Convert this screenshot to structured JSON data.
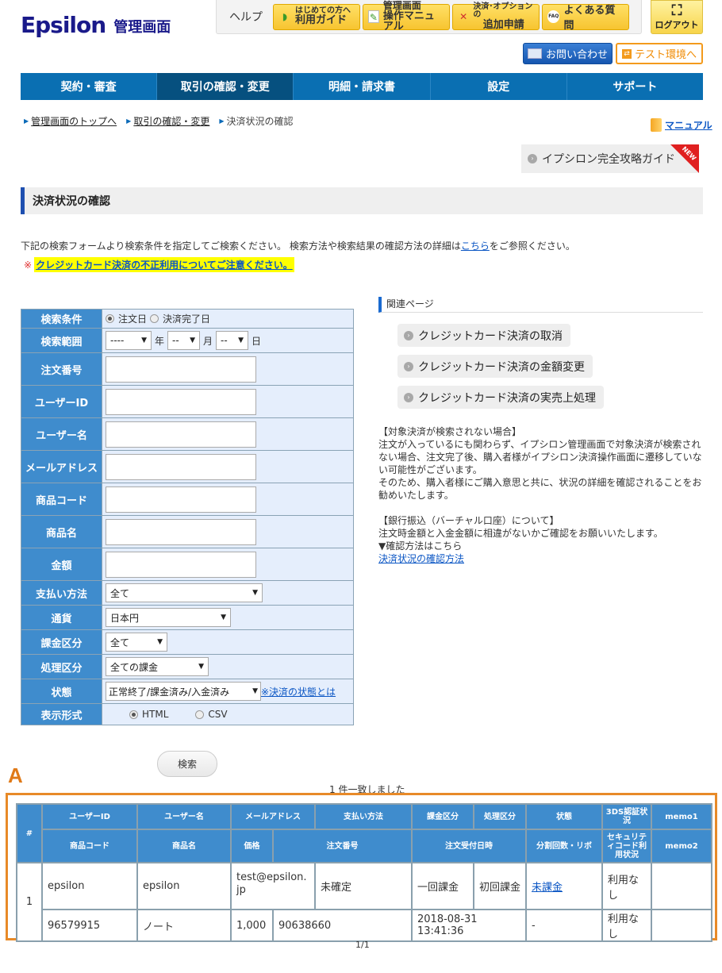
{
  "header": {
    "logo_main": "Epsilon",
    "logo_sub": "管理画面",
    "help_label": "ヘルプ",
    "help_buttons": [
      {
        "icon": "beginner-mark-icon",
        "small": "はじめての方へ",
        "large": "利用ガイド"
      },
      {
        "icon": "pencil-icon",
        "small": "管理画面",
        "large": "操作マニュアル"
      },
      {
        "icon": "tools-icon",
        "small": "決済･オプションの",
        "large": "追加申請"
      },
      {
        "icon": "faq-icon",
        "single": "よくある質問"
      }
    ],
    "logout_label": "ログアウト",
    "contact_label": "お問い合わせ",
    "test_env_label": "テスト環境へ"
  },
  "nav": {
    "items": [
      "契約・審査",
      "取引の確認・変更",
      "明細・請求書",
      "設定",
      "サポート"
    ],
    "active_index": 1
  },
  "breadcrumb": {
    "items": [
      "管理画面のトップへ",
      "取引の確認・変更"
    ],
    "current": "決済状況の確認"
  },
  "manual_link": "マニュアル",
  "guide_banner": {
    "label": "イプシロン完全攻略ガイド",
    "badge": "NEW"
  },
  "page_title": "決済状況の確認",
  "intro": {
    "before": "下記の検索フォームより検索条件を指定してご検索ください。 検索方法や検索結果の確認方法の詳細は",
    "link": "こちら",
    "after": "をご参照ください。"
  },
  "warning": {
    "mark": "※",
    "link": "クレジットカード決済の不正利用についてご注意ください。"
  },
  "search_form": {
    "condition": {
      "label": "検索条件",
      "options": [
        "注文日",
        "決済完了日"
      ],
      "selected": "注文日"
    },
    "range": {
      "label": "検索範囲",
      "year": "----",
      "year_unit": "年",
      "month": "--",
      "month_unit": "月",
      "day": "--",
      "day_unit": "日"
    },
    "text_fields": [
      {
        "label": "注文番号",
        "value": ""
      },
      {
        "label": "ユーザーID",
        "value": ""
      },
      {
        "label": "ユーザー名",
        "value": ""
      },
      {
        "label": "メールアドレス",
        "value": ""
      },
      {
        "label": "商品コード",
        "value": ""
      },
      {
        "label": "商品名",
        "value": ""
      },
      {
        "label": "金額",
        "value": ""
      }
    ],
    "payment_method": {
      "label": "支払い方法",
      "value": "全て"
    },
    "currency": {
      "label": "通貨",
      "value": "日本円"
    },
    "billing_type": {
      "label": "課金区分",
      "value": "全て"
    },
    "process_type": {
      "label": "処理区分",
      "value": "全ての課金"
    },
    "status": {
      "label": "状態",
      "value": "正常終了/課金済み/入金済み",
      "help_link": "※決済の状態とは"
    },
    "display_format": {
      "label": "表示形式",
      "options": [
        "HTML",
        "CSV"
      ],
      "selected": "HTML"
    },
    "submit_label": "検索"
  },
  "related": {
    "heading": "関連ページ",
    "links": [
      "クレジットカード決済の取消",
      "クレジットカード決済の金額変更",
      "クレジットカード決済の実売上処理"
    ]
  },
  "notes": {
    "not_found_title": "【対象決済が検索されない場合】",
    "not_found_body1": "注文が入っているにも関わらず、イプシロン管理画面で対象決済が検索されない場合、注文完了後、購入者様がイプシロン決済操作画面に遷移していない可能性がございます。",
    "not_found_body2": "そのため、購入者様にご購入意思と共に、状況の詳細を確認されることをお勧めいたします。",
    "bank_title": "【銀行振込（バーチャル口座）について】",
    "bank_body": "注文時金額と入金金額に相違がないかご確認をお願いいたします。",
    "bank_pointer": "▼確認方法はこちら",
    "bank_link": "決済状況の確認方法"
  },
  "results": {
    "annotation_label": "A",
    "match_text": "1 件一致しました",
    "header_row1": [
      "#",
      "ユーザーID",
      "ユーザー名",
      "メールアドレス",
      "支払い方法",
      "課金区分",
      "処理区分",
      "状態",
      "3DS認証状況",
      "memo1"
    ],
    "header_row2": [
      "商品コード",
      "商品名",
      "価格",
      "注文番号",
      "注文受付日時",
      "分割回数・リボ",
      "セキュリティコード利用状況",
      "memo2"
    ],
    "rows": [
      {
        "index": "1",
        "user_id": "epsilon",
        "user_name": "epsilon",
        "email": "test@epsilon.jp",
        "payment_method": "未確定",
        "billing_type": "一回課金",
        "process_type": "初回課金",
        "status": "未課金",
        "threeds": "利用なし",
        "memo1": "",
        "product_code": "96579915",
        "product_name": "ノート",
        "price": "1,000",
        "order_number": "90638660",
        "order_datetime": "2018-08-31 13:41:36",
        "installments": "-",
        "security_code": "利用なし",
        "memo2": ""
      }
    ],
    "pager": "1/1"
  }
}
